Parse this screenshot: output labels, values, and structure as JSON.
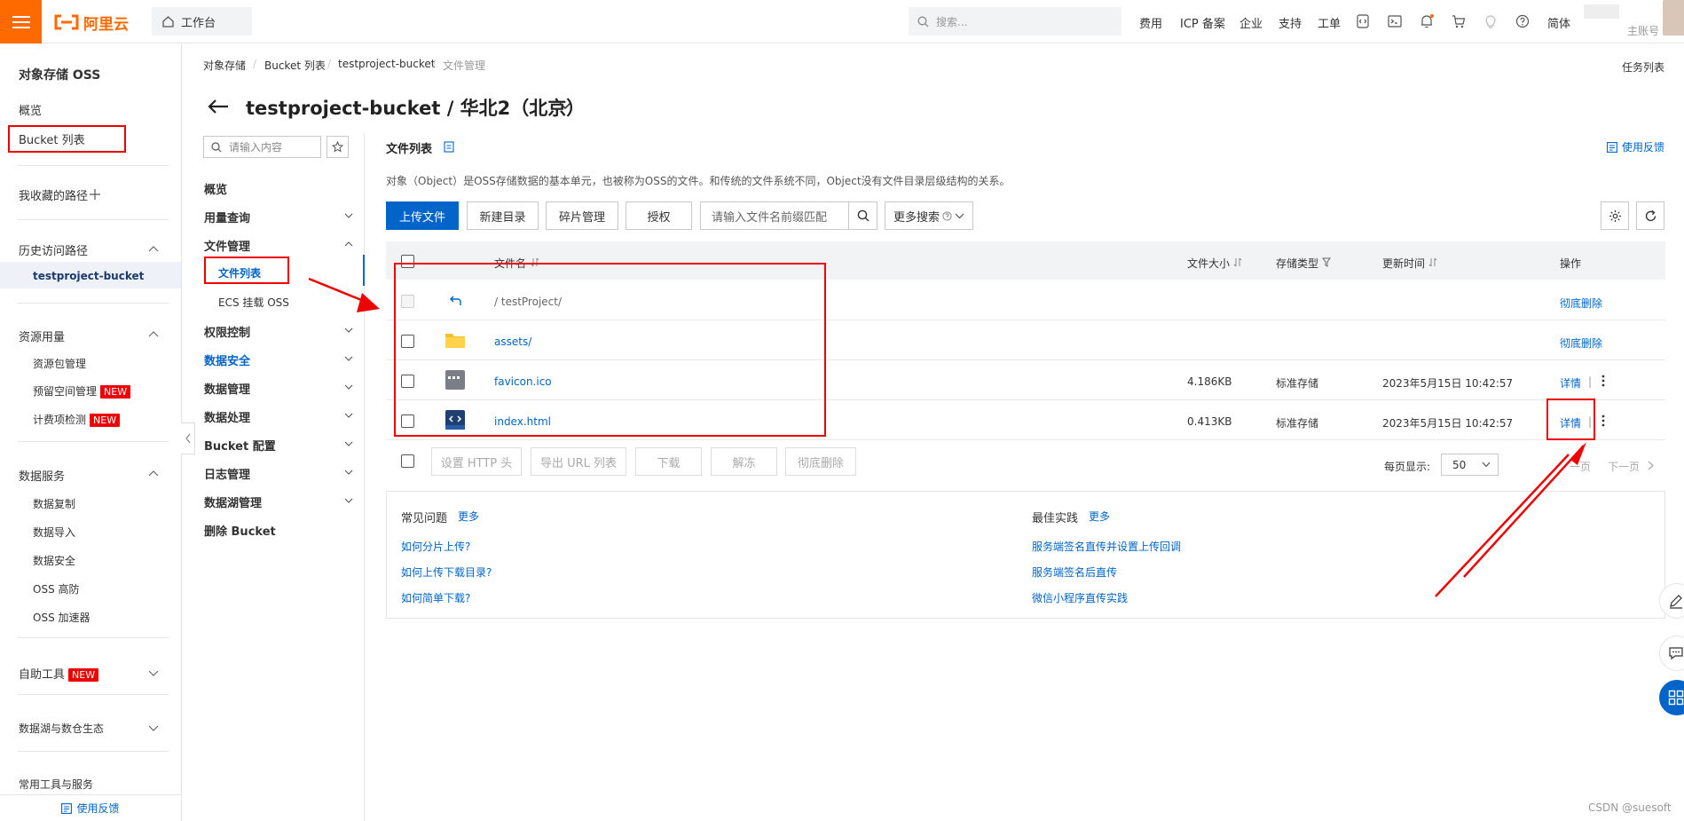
{
  "topbar": {
    "logo_text": "阿里云",
    "workbench": "工作台",
    "search_placeholder": "搜索...",
    "links": [
      "费用",
      "ICP 备案",
      "企业",
      "支持",
      "工单"
    ],
    "lang": "简体",
    "account": "主账号",
    "brand_color": "#ff6a00"
  },
  "leftnav": {
    "product_title": "对象存储 OSS",
    "overview": "概览",
    "bucket_list": "Bucket 列表",
    "favorites": "我收藏的路径",
    "history": "历史访问路径",
    "history_bucket": "testproject-bucket",
    "resource_usage": "资源用量",
    "resource_pack": "资源包管理",
    "reserved_space": "预留空间管理",
    "billing_check": "计费项检测",
    "new_badge": "NEW",
    "data_service": "数据服务",
    "data_replication": "数据复制",
    "data_import": "数据导入",
    "data_security": "数据安全",
    "oss_ddos": "OSS 高防",
    "oss_accelerator": "OSS 加速器",
    "self_tools": "自助工具",
    "data_lake": "数据湖与数仓生态",
    "common_tools": "常用工具与服务",
    "feedback": "使用反馈"
  },
  "breadcrumb": [
    "对象存储",
    "Bucket 列表",
    "testproject-bucket",
    "文件管理"
  ],
  "task_list": "任务列表",
  "page_title": "testproject-bucket / 华北2（北京）",
  "secnav": {
    "search_placeholder": "请输入内容",
    "items": {
      "overview": "概览",
      "usage_query": "用量查询",
      "file_mgmt": "文件管理",
      "file_list": "文件列表",
      "ecs_mount": "ECS 挂载 OSS",
      "access_control": "权限控制",
      "data_security": "数据安全",
      "data_mgmt": "数据管理",
      "data_processing": "数据处理",
      "bucket_config": "Bucket 配置",
      "log_mgmt": "日志管理",
      "data_lake_mgmt": "数据湖管理",
      "delete_bucket": "删除 Bucket"
    }
  },
  "content": {
    "section_title": "文件列表",
    "feedback": "使用反馈",
    "description": "对象（Object）是OSS存储数据的基本单元，也被称为OSS的文件。和传统的文件系统不同，Object没有文件目录层级结构的关系。",
    "toolbar": {
      "upload": "上传文件",
      "new_dir": "新建目录",
      "fragments": "碎片管理",
      "authorize": "授权",
      "prefix_placeholder": "请输入文件名前缀匹配",
      "more_search": "更多搜索"
    },
    "table": {
      "headers": [
        "文件名",
        "文件大小",
        "存储类型",
        "更新时间",
        "操作"
      ],
      "parent_path": "/ testProject/",
      "parent_action": "彻底删除",
      "rows": [
        {
          "name": "assets/",
          "size": "",
          "storage": "",
          "time": "",
          "action": "彻底删除",
          "type": "folder"
        },
        {
          "name": "favicon.ico",
          "size": "4.186KB",
          "storage": "标准存储",
          "time": "2023年5月15日 10:42:57",
          "action": "详情",
          "type": "image"
        },
        {
          "name": "index.html",
          "size": "0.413KB",
          "storage": "标准存储",
          "time": "2023年5月15日 10:42:57",
          "action": "详情",
          "type": "html"
        }
      ],
      "sep": "|"
    },
    "bulk": {
      "http_header": "设置 HTTP 头",
      "export_url": "导出 URL 列表",
      "download": "下载",
      "unfreeze": "解冻",
      "delete": "彻底删除"
    },
    "pagination": {
      "per_page_label": "每页显示:",
      "per_page": "50",
      "prev_partial": "一页",
      "next": "下一页"
    },
    "faq": {
      "title": "常见问题",
      "more": "更多",
      "items": [
        "如何分片上传?",
        "如何上传下载目录?",
        "如何简单下载?"
      ]
    },
    "best": {
      "title": "最佳实践",
      "more": "更多",
      "items": [
        "服务端签名直传并设置上传回调",
        "服务端签名后直传",
        "微信小程序直传实践"
      ]
    }
  },
  "watermark": "CSDN @suesoft",
  "colors": {
    "accent": "#0064c8",
    "annotation": "#ee0000"
  }
}
